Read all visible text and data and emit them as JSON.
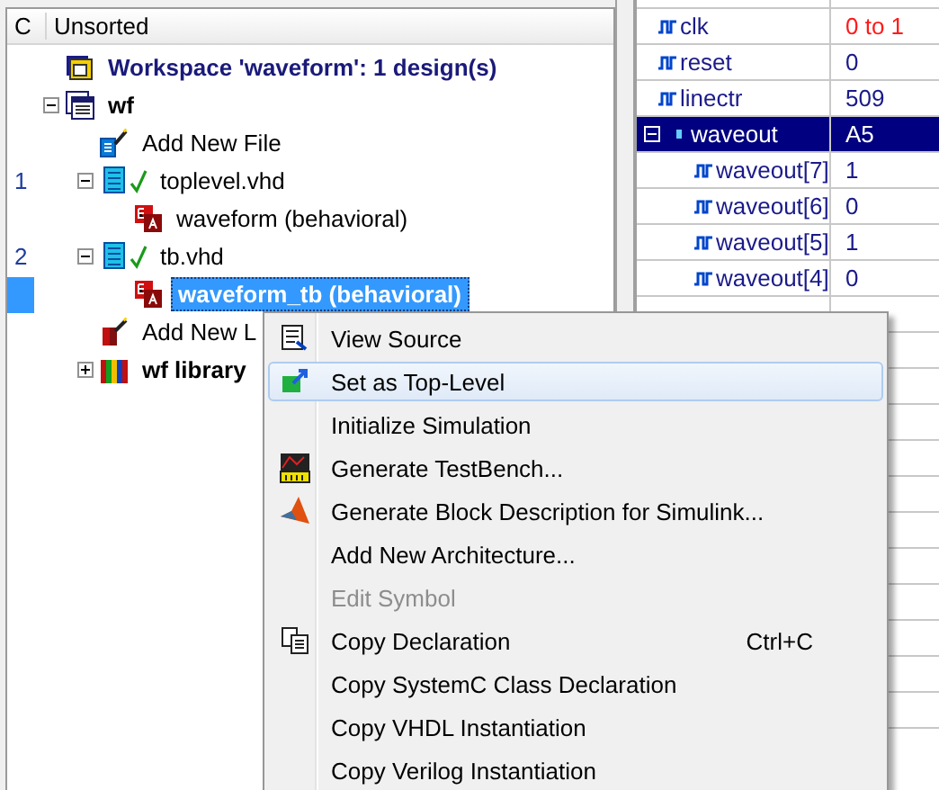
{
  "design_browser": {
    "header": {
      "column_1": "C",
      "column_2": "Unsorted"
    },
    "workspace": {
      "label": "Workspace 'waveform': 1 design(s)",
      "kind": "workspace"
    },
    "tree": [
      {
        "label": "wf",
        "kind": "design",
        "bold": true,
        "expanded": true,
        "children": [
          {
            "label": "Add New File",
            "kind": "add-file"
          },
          {
            "label": "toplevel.vhd",
            "kind": "vhd-file",
            "gutter": "1",
            "compiled": true,
            "expanded": true,
            "children": [
              {
                "label": "waveform (behavioral)",
                "kind": "entity",
                "selected": false
              }
            ]
          },
          {
            "label": "tb.vhd",
            "kind": "vhd-file",
            "gutter": "2",
            "compiled": true,
            "expanded": true,
            "children": [
              {
                "label": "waveform_tb (behavioral)",
                "kind": "entity",
                "selected": true
              }
            ]
          },
          {
            "label": "Add New L",
            "kind": "add-library"
          },
          {
            "label": "wf library",
            "kind": "library",
            "bold": true,
            "expanded": false
          }
        ]
      }
    ]
  },
  "signals": [
    {
      "name": "clk",
      "value": "0 to 1",
      "changing": true
    },
    {
      "name": "reset",
      "value": "0",
      "changing": false
    },
    {
      "name": "linectr",
      "value": "509",
      "changing": false
    },
    {
      "name": "waveout",
      "value": "A5",
      "changing": false,
      "selected": true,
      "expanded": true,
      "children": [
        {
          "name": "waveout[7]",
          "value": "1",
          "changing": false
        },
        {
          "name": "waveout[6]",
          "value": "0",
          "changing": false
        },
        {
          "name": "waveout[5]",
          "value": "1",
          "changing": false
        },
        {
          "name": "waveout[4]",
          "value": "0",
          "changing": false
        }
      ]
    }
  ],
  "context_menu": [
    {
      "label": "View Source",
      "kind": "source",
      "disabled": false,
      "selected": false
    },
    {
      "label": "Set as Top-Level",
      "kind": "top",
      "disabled": false,
      "selected": true
    },
    {
      "label": "Initialize Simulation",
      "disabled": false,
      "selected": false
    },
    {
      "label": "Generate TestBench...",
      "kind": "testbench",
      "disabled": false,
      "selected": false
    },
    {
      "label": "Generate Block Description for Simulink...",
      "kind": "simulink",
      "disabled": false,
      "selected": false
    },
    {
      "label": "Add New Architecture...",
      "disabled": false,
      "selected": false
    },
    {
      "label": "Edit Symbol",
      "disabled": true,
      "selected": false
    },
    {
      "label": "Copy Declaration",
      "kind": "copy",
      "shortcut": "Ctrl+C",
      "disabled": false,
      "selected": false
    },
    {
      "label": "Copy SystemC Class Declaration",
      "disabled": false,
      "selected": false
    },
    {
      "label": "Copy VHDL Instantiation",
      "disabled": false,
      "selected": false
    },
    {
      "label": "Copy Verilog Instantiation",
      "disabled": false,
      "selected": false
    }
  ]
}
